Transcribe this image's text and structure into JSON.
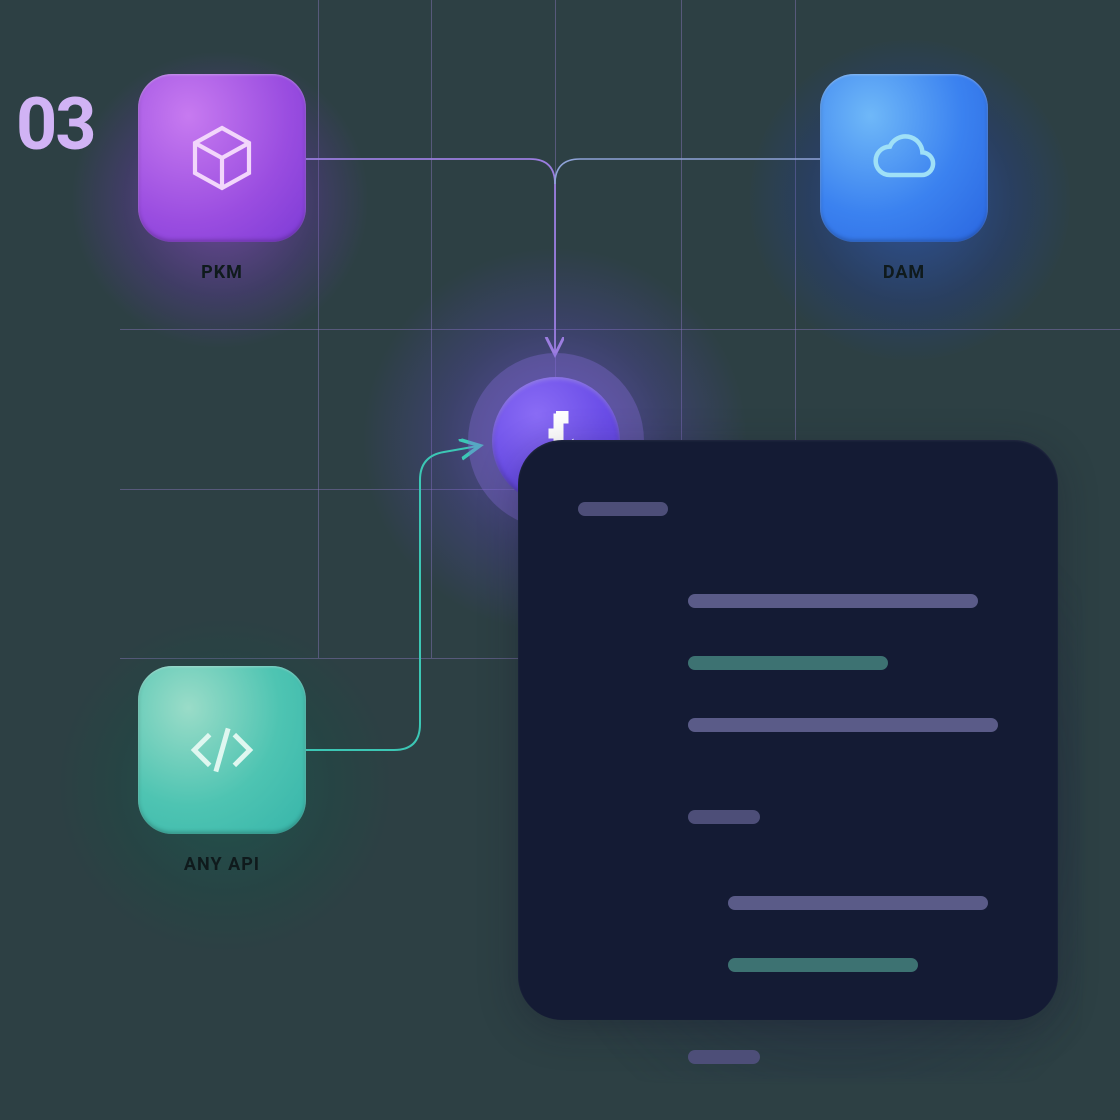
{
  "step_number": "03",
  "nodes": {
    "pkm": {
      "label": "PKM",
      "icon": "package-icon"
    },
    "dam": {
      "label": "DAM",
      "icon": "cloud-icon"
    },
    "api": {
      "label": "ANY API",
      "icon": "code-icon"
    },
    "hub": {
      "icon": "hub-logo-icon"
    }
  },
  "colors": {
    "pkm": "#a04ce0",
    "dam": "#3d82f0",
    "api": "#4ec4b2",
    "hub": "#6b4ee8",
    "panel": "#141b34"
  }
}
